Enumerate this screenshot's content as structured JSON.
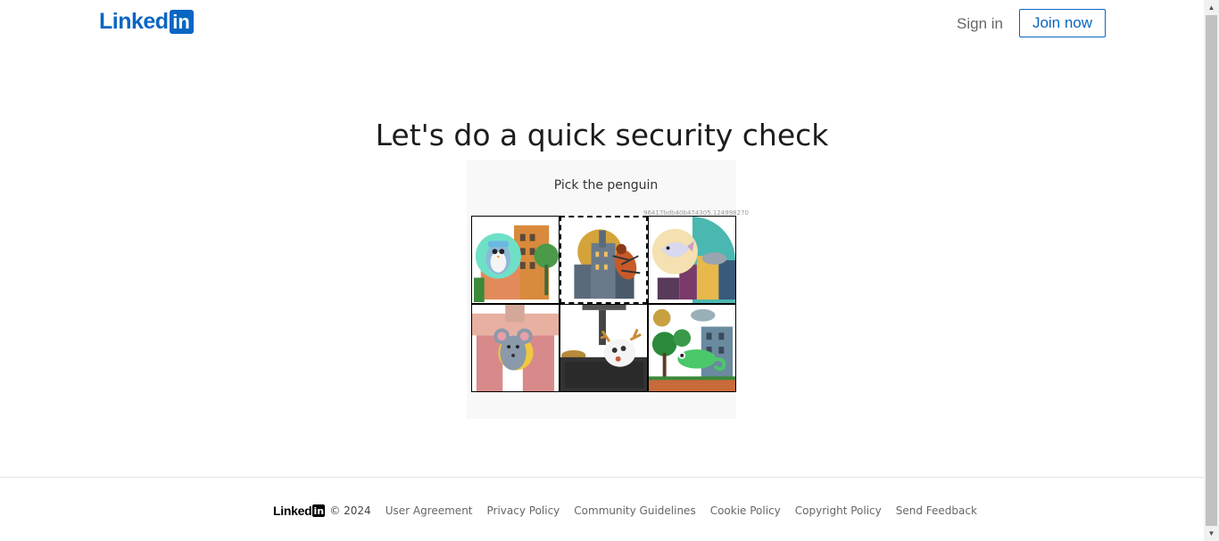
{
  "header": {
    "logo_text": "Linked",
    "logo_box": "in",
    "signin_label": "Sign in",
    "join_label": "Join now"
  },
  "main": {
    "title": "Let's do a quick security check",
    "captcha": {
      "prompt": "Pick the penguin",
      "session_id": "96417bdb40b474305.124998270",
      "tiles": [
        {
          "subject": "penguin",
          "selected": false
        },
        {
          "subject": "beetle",
          "selected": true
        },
        {
          "subject": "whale",
          "selected": false
        },
        {
          "subject": "mouse",
          "selected": false
        },
        {
          "subject": "deer",
          "selected": false
        },
        {
          "subject": "chameleon",
          "selected": false
        }
      ]
    }
  },
  "footer": {
    "logo_text": "Linked",
    "logo_box": "in",
    "copyright": "© 2024",
    "links": [
      "User Agreement",
      "Privacy Policy",
      "Community Guidelines",
      "Cookie Policy",
      "Copyright Policy",
      "Send Feedback"
    ]
  },
  "colors": {
    "brand": "#0a66c2",
    "captcha_bg": "#f8f8f8"
  }
}
